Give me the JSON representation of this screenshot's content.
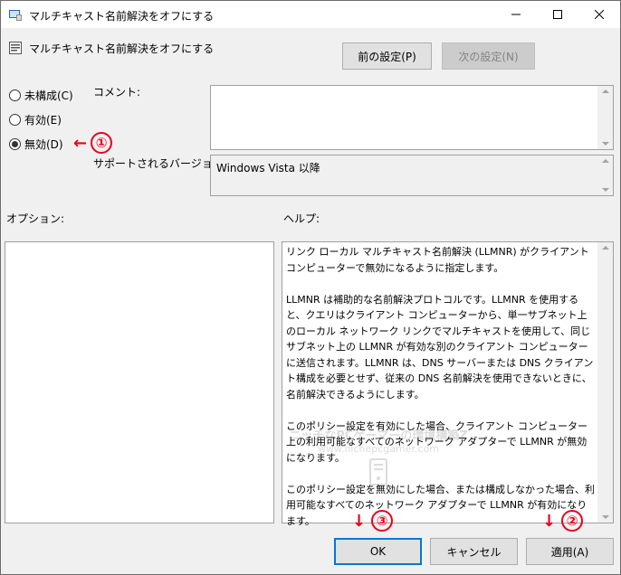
{
  "window": {
    "title": "マルチキャスト名前解決をオフにする"
  },
  "header": {
    "title": "マルチキャスト名前解決をオフにする",
    "prev_label": "前の設定(P)",
    "next_label": "次の設定(N)"
  },
  "state": {
    "options": [
      {
        "label": "未構成(C)",
        "checked": false
      },
      {
        "label": "有効(E)",
        "checked": false
      },
      {
        "label": "無効(D)",
        "checked": true
      }
    ]
  },
  "comment": {
    "label": "コメント:",
    "value": ""
  },
  "supported": {
    "label": "サポートされるバージョン:",
    "value": "Windows Vista 以降"
  },
  "options_panel": {
    "label": "オプション:"
  },
  "help_panel": {
    "label": "ヘルプ:",
    "text": "リンク ローカル マルチキャスト名前解決 (LLMNR) がクライアント コンピューターで無効になるように指定します。\n\nLLMNR は補助的な名前解決プロトコルです。LLMNR を使用すると、クエリはクライアント コンピューターから、単一サブネット上のローカル ネットワーク リンクでマルチキャストを使用して、同じサブネット上の LLMNR が有効な別のクライアント コンピューターに送信されます。LLMNR は、DNS サーバーまたは DNS クライアント構成を必要とせず、従来の DNS 名前解決を使用できないときに、名前解決できるようにします。\n\nこのポリシー設定を有効にした場合、クライアント コンピューター上の利用可能なすべてのネットワーク アダプターで LLMNR が無効になります。\n\nこのポリシー設定を無効にした場合、または構成しなかった場合、利用可能なすべてのネットワーク アダプターで LLMNR が有効になります。"
  },
  "footer": {
    "ok_label": "OK",
    "cancel_label": "キャンセル",
    "apply_label": "適用(A)"
  },
  "annotations": {
    "step1": "①",
    "step2": "②",
    "step3": "③",
    "arrow_left": "←",
    "arrow_down": "↓",
    "color": "#e8001b"
  },
  "watermark": {
    "line1": "ニッチなPCゲーマーの環境構築Z",
    "line2": "www.nichepcgamer.com"
  }
}
